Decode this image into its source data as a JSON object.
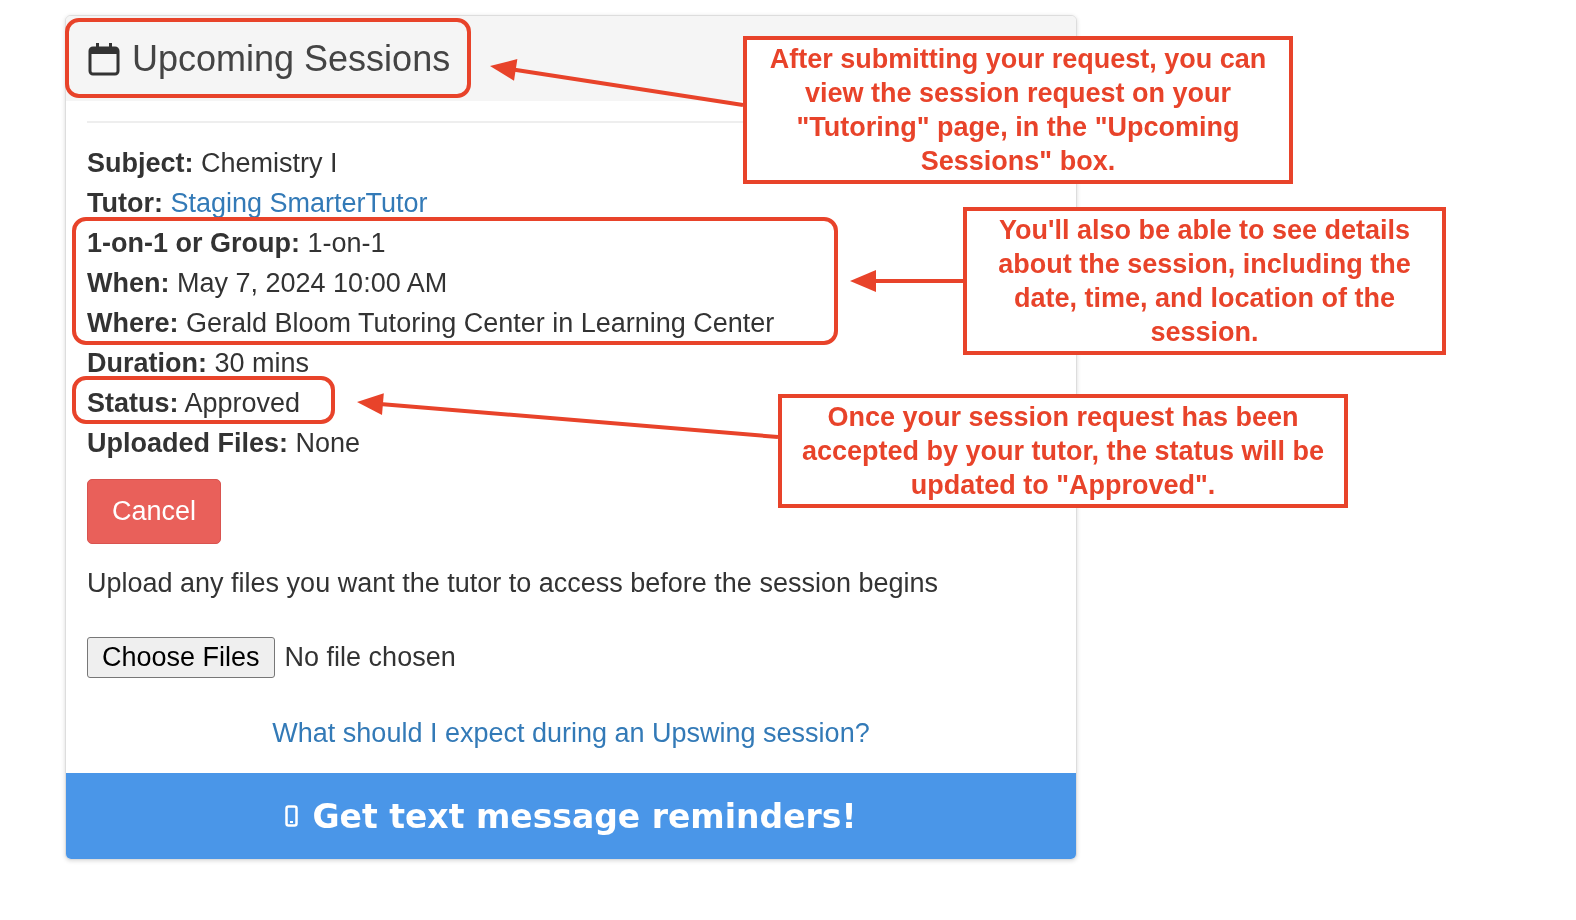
{
  "panel": {
    "title": "Upcoming Sessions",
    "details": [
      {
        "label": "Subject:",
        "value": "Chemistry I",
        "kind": "text"
      },
      {
        "label": "Tutor:",
        "value": "Staging SmarterTutor",
        "kind": "link"
      },
      {
        "label": "1-on-1 or Group:",
        "value": "1-on-1",
        "kind": "text"
      },
      {
        "label": "When:",
        "value": "May 7, 2024 10:00 AM",
        "kind": "text"
      },
      {
        "label": "Where:",
        "value": "Gerald Bloom Tutoring Center in Learning Center",
        "kind": "text"
      },
      {
        "label": "Duration:",
        "value": "30 mins",
        "kind": "text"
      },
      {
        "label": "Status:",
        "value": "Approved",
        "kind": "text"
      },
      {
        "label": "Uploaded Files:",
        "value": "None",
        "kind": "text"
      }
    ],
    "cancel_button": "Cancel",
    "upload_prompt": "Upload any files you want the tutor to access before the session begins",
    "file_input": {
      "button": "Choose Files",
      "status": "No file chosen"
    },
    "help_link": "What should I expect during an Upswing session?",
    "reminder_bar": "Get text message reminders!"
  },
  "annotations": [
    {
      "text": "After submitting your request, you can view the session request on your \"Tutoring\" page, in the \"Upcoming Sessions\" box."
    },
    {
      "text": "You'll also be able to see details about the session, including the date, time, and location of the session."
    },
    {
      "text": "Once your session request has been accepted by your tutor, the status will be updated to \"Approved\"."
    }
  ]
}
